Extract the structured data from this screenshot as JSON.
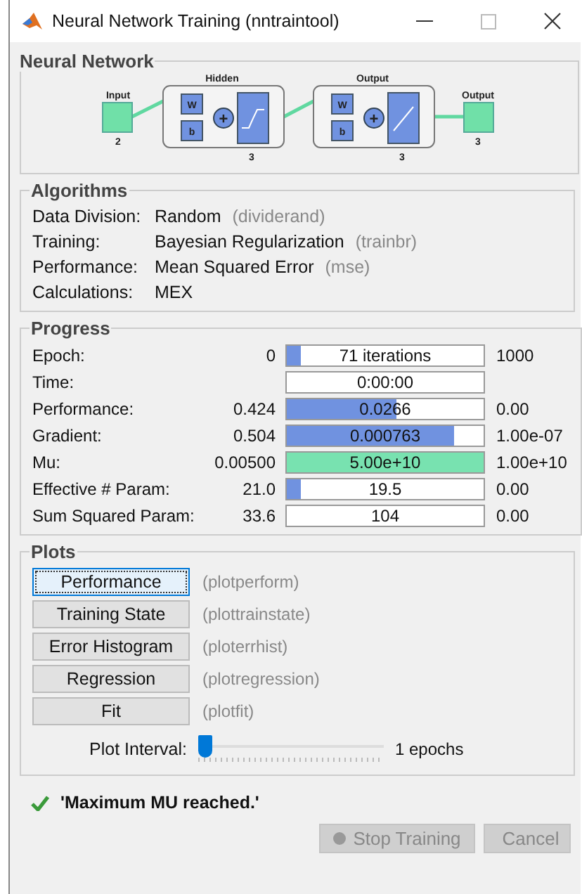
{
  "window": {
    "title": "Neural Network Training (nntraintool)"
  },
  "network": {
    "title": "Neural Network",
    "input": {
      "label": "Input",
      "size": "2"
    },
    "layers": [
      {
        "title": "Hidden",
        "weight": "W",
        "bias": "b",
        "sum": "+",
        "size": "3",
        "kind": "sigmoid"
      },
      {
        "title": "Output",
        "weight": "W",
        "bias": "b",
        "sum": "+",
        "size": "3",
        "kind": "linear"
      }
    ],
    "output": {
      "label": "Output",
      "size": "3"
    }
  },
  "algorithms": {
    "title": "Algorithms",
    "rows": [
      {
        "label": "Data Division:",
        "value": "Random",
        "code": "(dividerand)"
      },
      {
        "label": "Training:",
        "value": "Bayesian Regularization",
        "code": "(trainbr)"
      },
      {
        "label": "Performance:",
        "value": "Mean Squared Error",
        "code": "(mse)"
      },
      {
        "label": "Calculations:",
        "value": "MEX"
      }
    ]
  },
  "progress": {
    "title": "Progress",
    "rows": [
      {
        "label": "Epoch:",
        "start": "0",
        "bar": "71 iterations",
        "level": 0.07,
        "color": "#7092e0",
        "end": "1000"
      },
      {
        "label": "Time:",
        "bar": "0:00:00"
      },
      {
        "label": "Performance:",
        "start": "0.424",
        "bar": "0.0266",
        "level": 0.56,
        "color": "#7092e0",
        "end": "0.00"
      },
      {
        "label": "Gradient:",
        "start": "0.504",
        "bar": "0.000763",
        "level": 0.85,
        "color": "#7092e0",
        "end": "1.00e-07"
      },
      {
        "label": "Mu:",
        "start": "0.00500",
        "bar": "5.00e+10",
        "level": 1,
        "color": "#78e2b0",
        "end": "1.00e+10"
      },
      {
        "label": "Effective # Param:",
        "start": "21.0",
        "bar": "19.5",
        "level": 0.07,
        "color": "#7092e0",
        "end": "0.00"
      },
      {
        "label": "Sum Squared Param:",
        "start": "33.6",
        "bar": "104",
        "end": "0.00"
      }
    ]
  },
  "plots": {
    "title": "Plots",
    "buttons": [
      {
        "label": "Performance",
        "code": "(plotperform)",
        "focused": true
      },
      {
        "label": "Training State",
        "code": "(plottrainstate)",
        "focused": false
      },
      {
        "label": "Error Histogram",
        "code": "(ploterrhist)",
        "focused": false
      },
      {
        "label": "Regression",
        "code": "(plotregression)",
        "focused": false
      },
      {
        "label": "Fit",
        "code": "(plotfit)",
        "focused": false
      }
    ],
    "interval": {
      "label": "Plot Interval:",
      "level": 0,
      "reading": "1 epochs"
    }
  },
  "status": {
    "message": "'Maximum MU reached.'"
  },
  "buttons": [
    {
      "label": "Stop Training",
      "disabled": true
    },
    {
      "label": "Cancel",
      "disabled": true
    }
  ]
}
